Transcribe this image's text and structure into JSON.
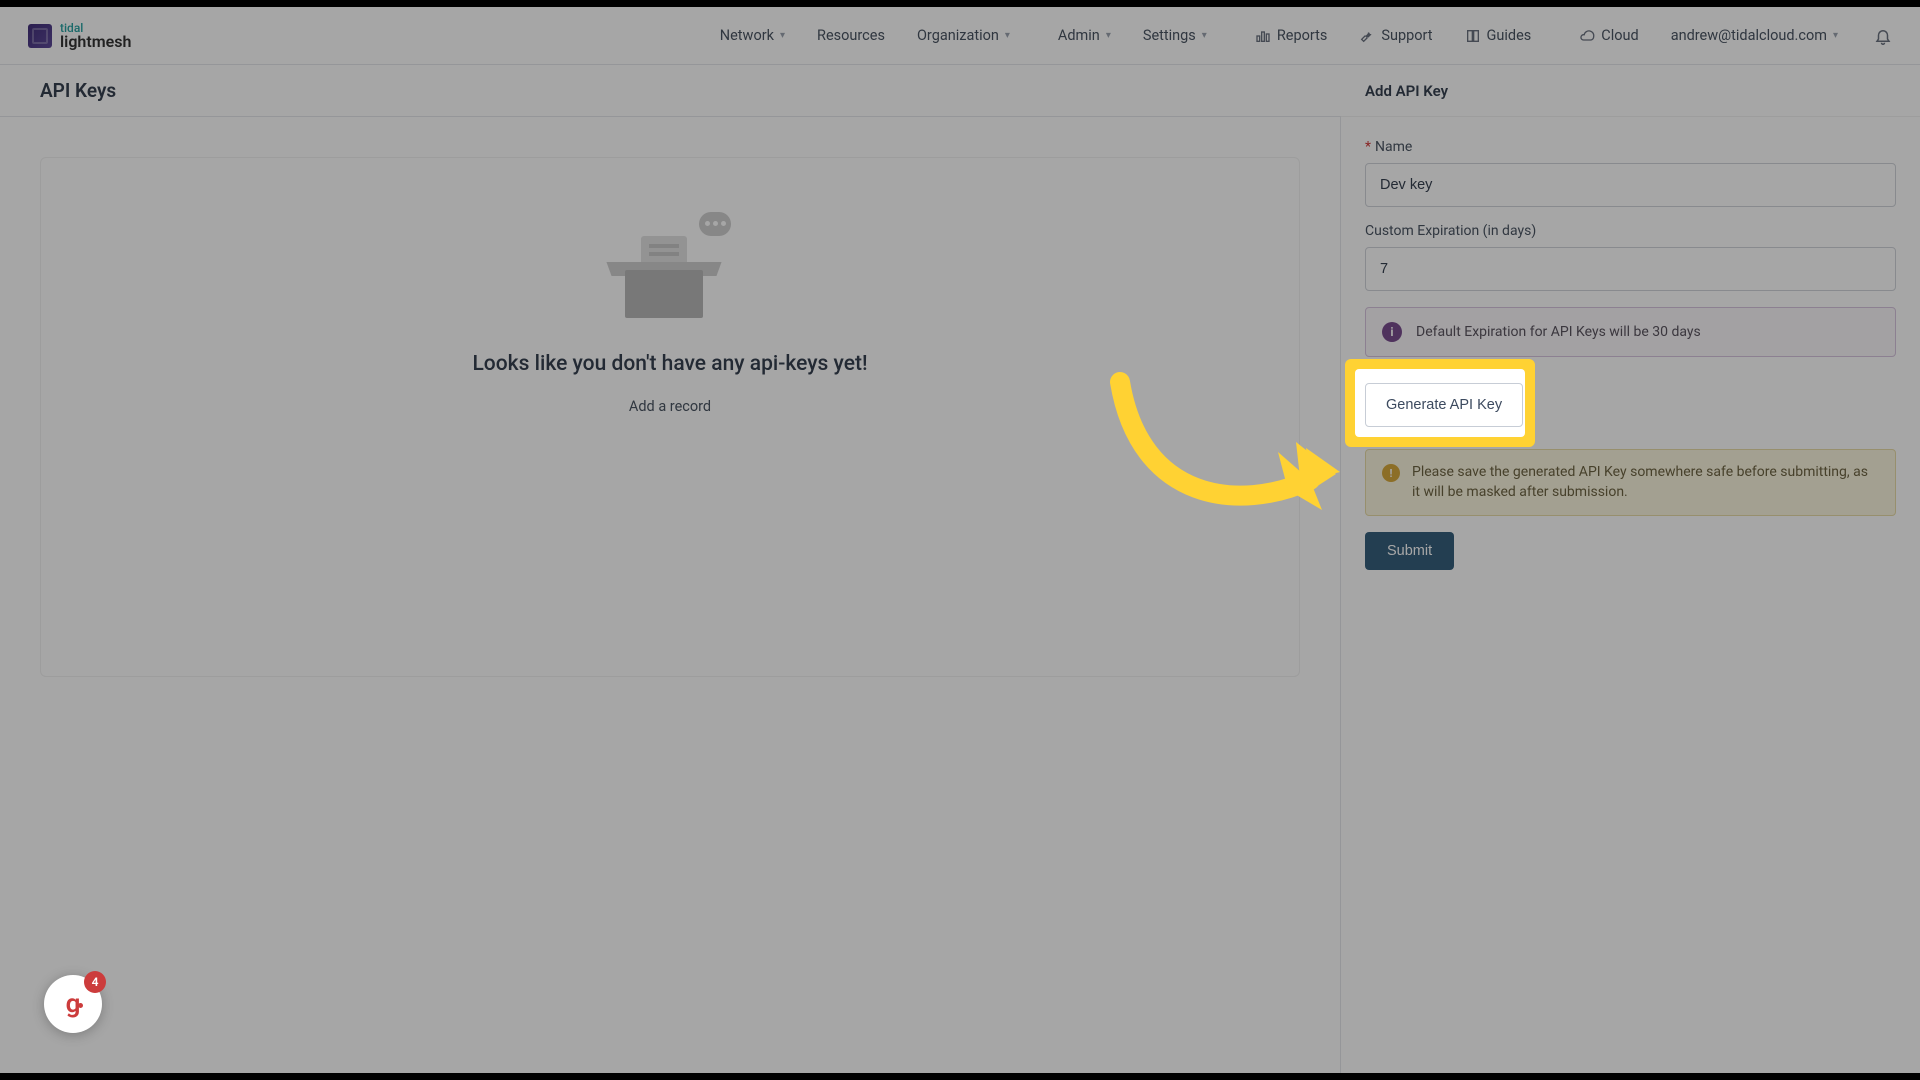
{
  "brand": {
    "line1": "tidal",
    "line2": "lightmesh"
  },
  "nav": {
    "network": "Network",
    "resources": "Resources",
    "organization": "Organization",
    "admin": "Admin",
    "settings": "Settings",
    "reports": "Reports",
    "support": "Support",
    "guides": "Guides",
    "cloud": "Cloud",
    "user_email": "andrew@tidalcloud.com"
  },
  "page": {
    "title": "API Keys"
  },
  "empty": {
    "title": "Looks like you don't have any api-keys yet!",
    "add_record": "Add a record"
  },
  "panel": {
    "title": "Add API Key",
    "name_label": "Name",
    "name_value": "Dev key",
    "expiration_label": "Custom Expiration (in days)",
    "expiration_value": "7",
    "info_text": "Default Expiration for API Keys will be 30 days",
    "generate_label": "Generate API Key",
    "warn_text": "Please save the generated API Key somewhere safe before submitting, as it will be masked after submission.",
    "submit_label": "Submit"
  },
  "fab": {
    "badge": "4"
  }
}
